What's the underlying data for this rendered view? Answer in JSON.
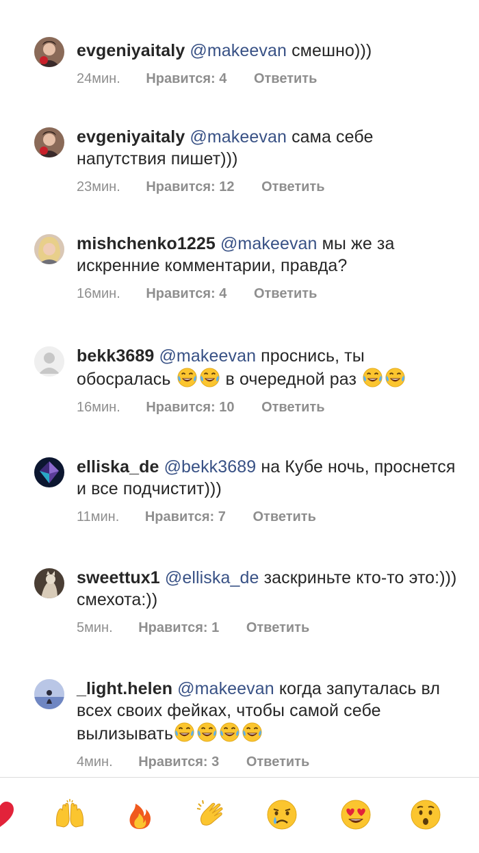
{
  "comments": [
    {
      "username": "evgeniyaitaly",
      "mention": "@makeevan",
      "text": "смешно)))",
      "time": "24мин.",
      "likes": "Нравится: 4",
      "reply": "Ответить"
    },
    {
      "username": "evgeniyaitaly",
      "mention": "@makeevan",
      "text": "сама себе напутствия пишет)))",
      "time": "23мин.",
      "likes": "Нравится: 12",
      "reply": "Ответить"
    },
    {
      "username": "mishchenko1225",
      "mention": "@makeevan",
      "text": "мы же за искренние комментарии, правда?",
      "time": "16мин.",
      "likes": "Нравится: 4",
      "reply": "Ответить"
    },
    {
      "username": "bekk3689",
      "mention": "@makeevan",
      "text_a": "проснись, ты обосралась",
      "text_b": "в очередной раз",
      "time": "16мин.",
      "likes": "Нравится: 10",
      "reply": "Ответить"
    },
    {
      "username": "elliska_de",
      "mention": "@bekk3689",
      "text": "на Кубе ночь, проснется и все подчистит)))",
      "time": "11мин.",
      "likes": "Нравится: 7",
      "reply": "Ответить"
    },
    {
      "username": "sweettux1",
      "mention": "@elliska_de",
      "text": "заскриньте кто-то это:))) смехота:))",
      "time": "5мин.",
      "likes": "Нравится: 1",
      "reply": "Ответить"
    },
    {
      "username": "_light.helen",
      "mention": "@makeevan",
      "text": "когда запуталась вл всех своих фейках, чтобы самой себе вылизывать",
      "time": "4мин.",
      "likes": "Нравится: 3",
      "reply": "Ответить"
    }
  ],
  "emoji_bar": [
    {
      "icon": "heart-icon"
    },
    {
      "icon": "raised-hands-icon"
    },
    {
      "icon": "fire-icon"
    },
    {
      "icon": "clapping-hands-icon"
    },
    {
      "icon": "crying-face-icon"
    },
    {
      "icon": "heart-eyes-icon"
    },
    {
      "icon": "surprised-face-icon"
    }
  ],
  "colors": {
    "text": "#262626",
    "mention": "#385185",
    "meta": "#8e8e8e",
    "emoji_yellow": "#fbc52f",
    "heart_red": "#e2233a"
  }
}
